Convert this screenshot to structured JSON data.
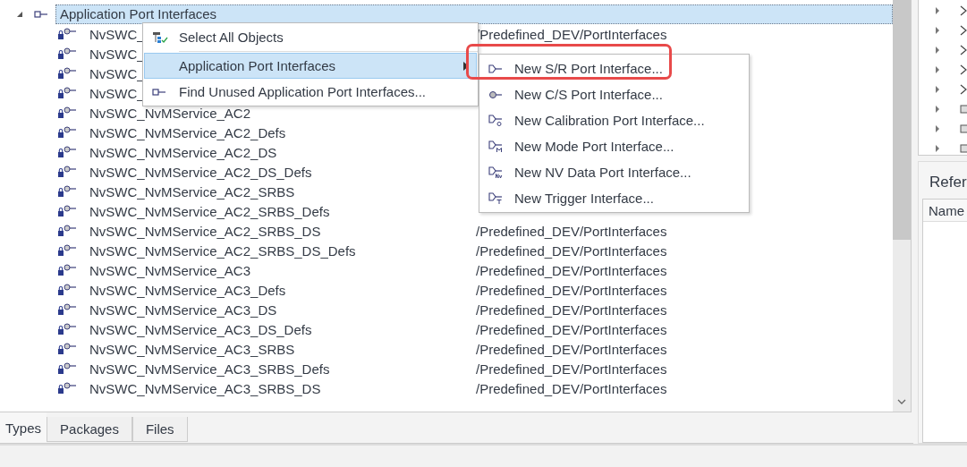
{
  "tree": {
    "root": {
      "label": "Application Port Interfaces",
      "expanded": true,
      "selected": true,
      "children": [
        {
          "name": "NvSWC_",
          "path": "/Predefined_DEV/PortInterfaces"
        },
        {
          "name": "NvSWC_"
        },
        {
          "name": "NvSWC_"
        },
        {
          "name": "NvSWC_"
        },
        {
          "name": "NvSWC_NvMService_AC2"
        },
        {
          "name": "NvSWC_NvMService_AC2_Defs"
        },
        {
          "name": "NvSWC_NvMService_AC2_DS"
        },
        {
          "name": "NvSWC_NvMService_AC2_DS_Defs"
        },
        {
          "name": "NvSWC_NvMService_AC2_SRBS"
        },
        {
          "name": "NvSWC_NvMService_AC2_SRBS_Defs"
        },
        {
          "name": "NvSWC_NvMService_AC2_SRBS_DS",
          "path": "/Predefined_DEV/PortInterfaces"
        },
        {
          "name": "NvSWC_NvMService_AC2_SRBS_DS_Defs",
          "path": "/Predefined_DEV/PortInterfaces"
        },
        {
          "name": "NvSWC_NvMService_AC3",
          "path": "/Predefined_DEV/PortInterfaces"
        },
        {
          "name": "NvSWC_NvMService_AC3_Defs",
          "path": "/Predefined_DEV/PortInterfaces"
        },
        {
          "name": "NvSWC_NvMService_AC3_DS",
          "path": "/Predefined_DEV/PortInterfaces"
        },
        {
          "name": "NvSWC_NvMService_AC3_DS_Defs",
          "path": "/Predefined_DEV/PortInterfaces"
        },
        {
          "name": "NvSWC_NvMService_AC3_SRBS",
          "path": "/Predefined_DEV/PortInterfaces"
        },
        {
          "name": "NvSWC_NvMService_AC3_SRBS_Defs",
          "path": "/Predefined_DEV/PortInterfaces"
        },
        {
          "name": "NvSWC_NvMService_AC3_SRBS_DS",
          "path": "/Predefined_DEV/PortInterfaces"
        }
      ]
    }
  },
  "context_menu": {
    "items": [
      {
        "label": "Select All Objects",
        "kind": "select",
        "selected": false,
        "submenu": false
      },
      {
        "label": "Application Port Interfaces",
        "kind": "plain",
        "selected": true,
        "submenu": true
      },
      {
        "label": "Find Unused Application Port Interfaces...",
        "kind": "port",
        "selected": false,
        "submenu": false
      }
    ]
  },
  "submenu": {
    "items": [
      {
        "label": "New S/R Port Interface...",
        "kind": "sender",
        "highlighted": true
      },
      {
        "label": "New C/S Port Interface...",
        "kind": "client",
        "highlighted": false
      },
      {
        "label": "New Calibration Port Interface...",
        "kind": "calibration",
        "highlighted": false
      },
      {
        "label": "New Mode Port Interface...",
        "kind": "mode",
        "highlighted": false
      },
      {
        "label": "New NV Data Port Interface...",
        "kind": "nvdata",
        "highlighted": false
      },
      {
        "label": "New Trigger Interface...",
        "kind": "trigger",
        "highlighted": false
      }
    ]
  },
  "bottom_tabs": [
    {
      "label": "Types",
      "selected": true
    },
    {
      "label": "Packages",
      "selected": false
    },
    {
      "label": "Files",
      "selected": false
    }
  ],
  "side_tree": {
    "items": [
      {
        "kind": "chevron"
      },
      {
        "kind": "chevron"
      },
      {
        "kind": "chevron"
      },
      {
        "kind": "chevron"
      },
      {
        "kind": "chevron"
      },
      {
        "kind": "box"
      },
      {
        "kind": "box"
      },
      {
        "kind": "box"
      }
    ]
  },
  "references_panel": {
    "title": "Refer",
    "columns": [
      "Name"
    ]
  }
}
